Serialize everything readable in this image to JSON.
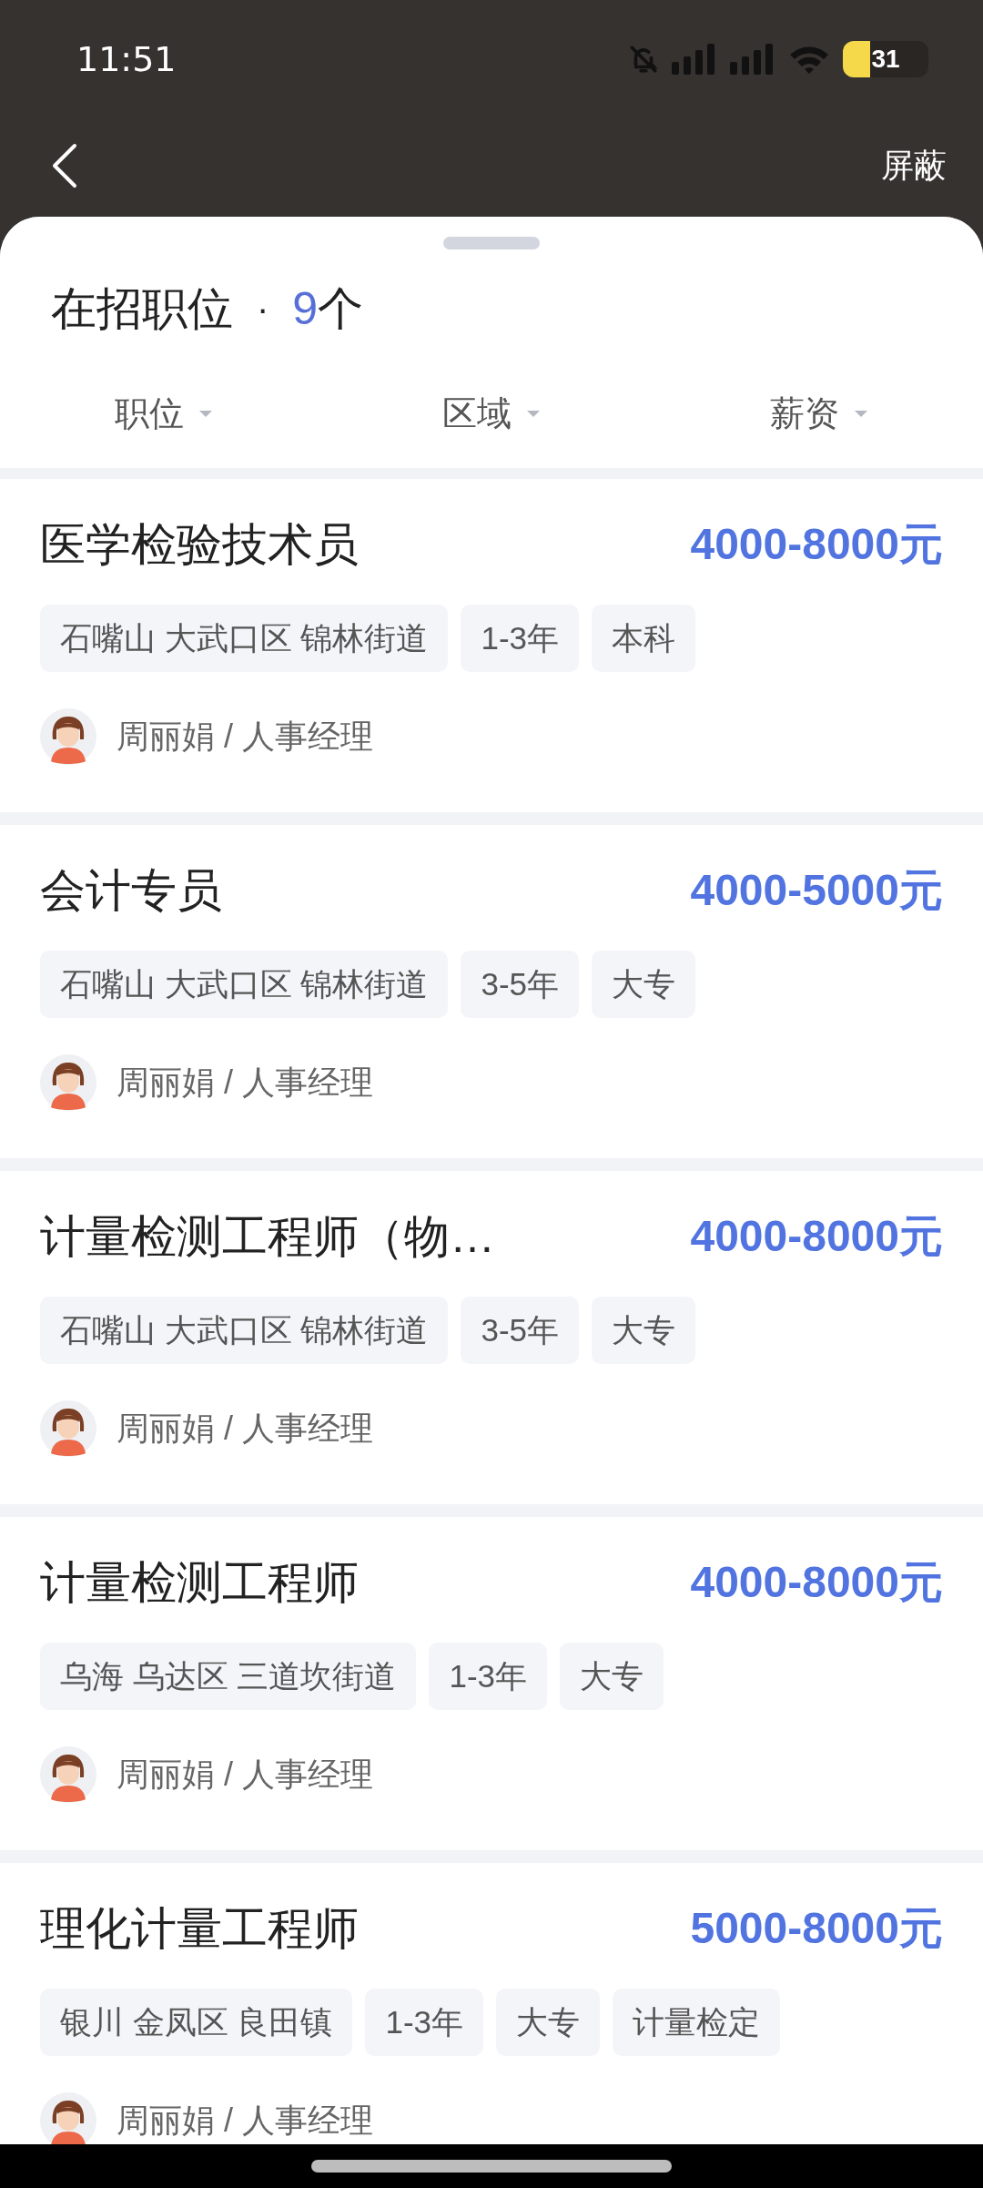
{
  "status_bar": {
    "time": "11:51",
    "battery": "31"
  },
  "nav": {
    "action": "屏蔽"
  },
  "header": {
    "title": "在招职位",
    "separator": "·",
    "count": "9",
    "unit": "个"
  },
  "filters": [
    {
      "label": "职位"
    },
    {
      "label": "区域"
    },
    {
      "label": "薪资"
    }
  ],
  "jobs": [
    {
      "title": "医学检验技术员",
      "salary": "4000-8000元",
      "tags": [
        "石嘴山 大武口区 锦林街道",
        "1-3年",
        "本科"
      ],
      "recruiter": "周丽娟 / 人事经理"
    },
    {
      "title": "会计专员",
      "salary": "4000-5000元",
      "tags": [
        "石嘴山 大武口区 锦林街道",
        "3-5年",
        "大专"
      ],
      "recruiter": "周丽娟 / 人事经理"
    },
    {
      "title": "计量检测工程师（物…",
      "salary": "4000-8000元",
      "tags": [
        "石嘴山 大武口区 锦林街道",
        "3-5年",
        "大专"
      ],
      "recruiter": "周丽娟 / 人事经理"
    },
    {
      "title": "计量检测工程师",
      "salary": "4000-8000元",
      "tags": [
        "乌海 乌达区 三道坎街道",
        "1-3年",
        "大专"
      ],
      "recruiter": "周丽娟 / 人事经理"
    },
    {
      "title": "理化计量工程师",
      "salary": "5000-8000元",
      "tags": [
        "银川 金凤区 良田镇",
        "1-3年",
        "大专",
        "计量检定"
      ],
      "recruiter": "周丽娟 / 人事经理"
    }
  ]
}
